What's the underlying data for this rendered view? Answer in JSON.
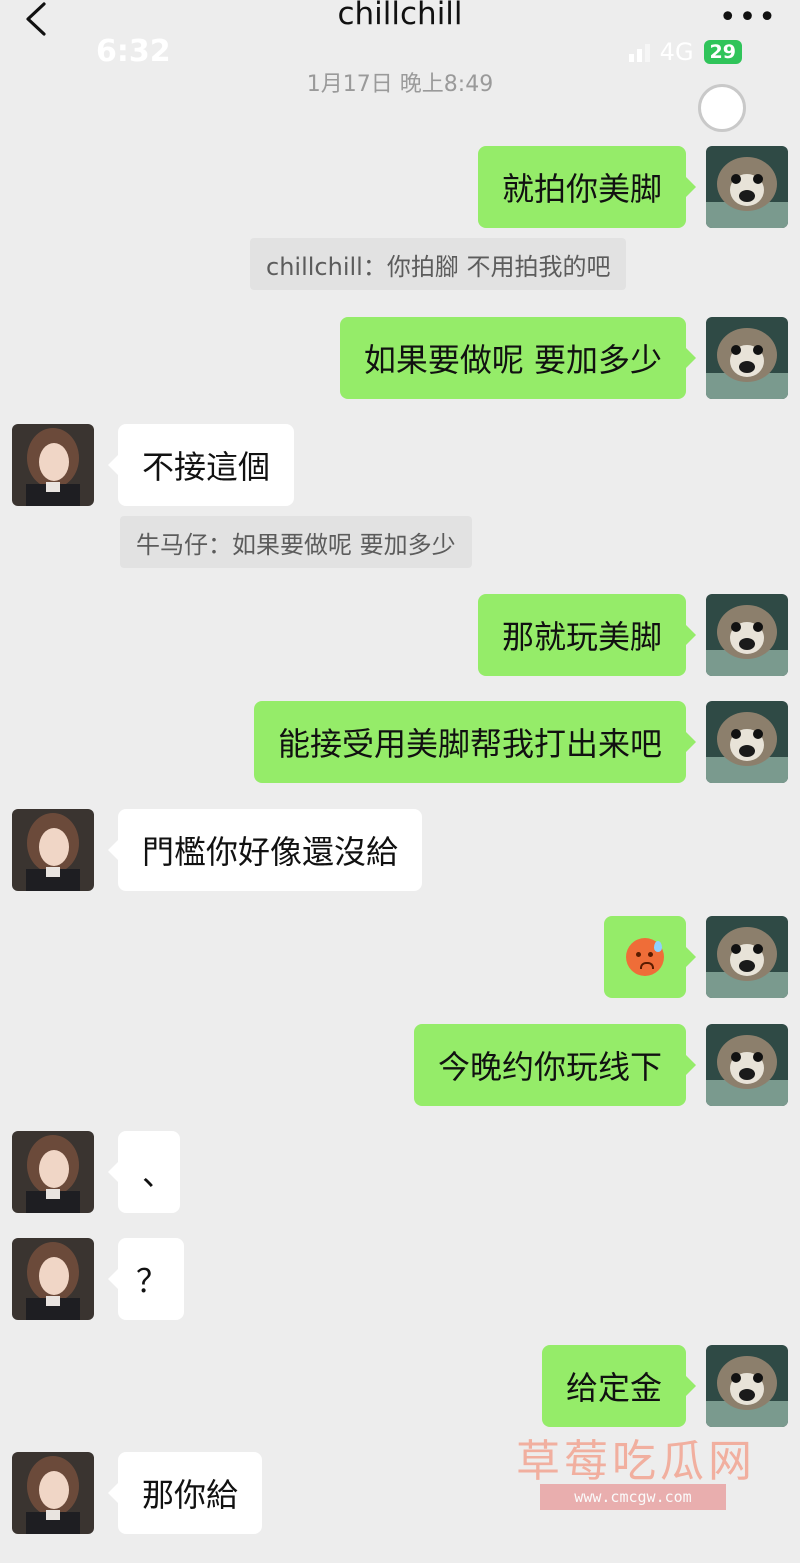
{
  "header": {
    "title": "chillchill",
    "more_label": "•••",
    "status_time": "6:32",
    "network": "4G",
    "battery": "29"
  },
  "timestamp": "1月17日 晚上8:49",
  "messages": [
    {
      "side": "me",
      "text": "就拍你美脚"
    },
    {
      "side": "quote",
      "text": "chillchill：你拍腳 不用拍我的吧"
    },
    {
      "side": "me",
      "text": "如果要做呢 要加多少"
    },
    {
      "side": "her",
      "text": "不接這個"
    },
    {
      "side": "quote",
      "text": "牛马仔：如果要做呢 要加多少"
    },
    {
      "side": "me",
      "text": "那就玩美脚"
    },
    {
      "side": "me",
      "text": "能接受用美脚帮我打出来吧"
    },
    {
      "side": "her",
      "text": "門檻你好像還沒給"
    },
    {
      "side": "me",
      "emoji": "cold-sweat-emoji"
    },
    {
      "side": "me",
      "text": "今晚约你玩线下"
    },
    {
      "side": "her",
      "text": "、"
    },
    {
      "side": "her",
      "text": "？"
    },
    {
      "side": "me",
      "text": "给定金"
    },
    {
      "side": "her",
      "text": "那你給"
    }
  ],
  "watermark": {
    "text": "草莓吃瓜网",
    "url": "www.cmcgw.com"
  },
  "colors": {
    "background": "#ededed",
    "my_bubble": "#95ec69",
    "her_bubble": "#ffffff",
    "quote_bg": "#e2e2e2"
  }
}
